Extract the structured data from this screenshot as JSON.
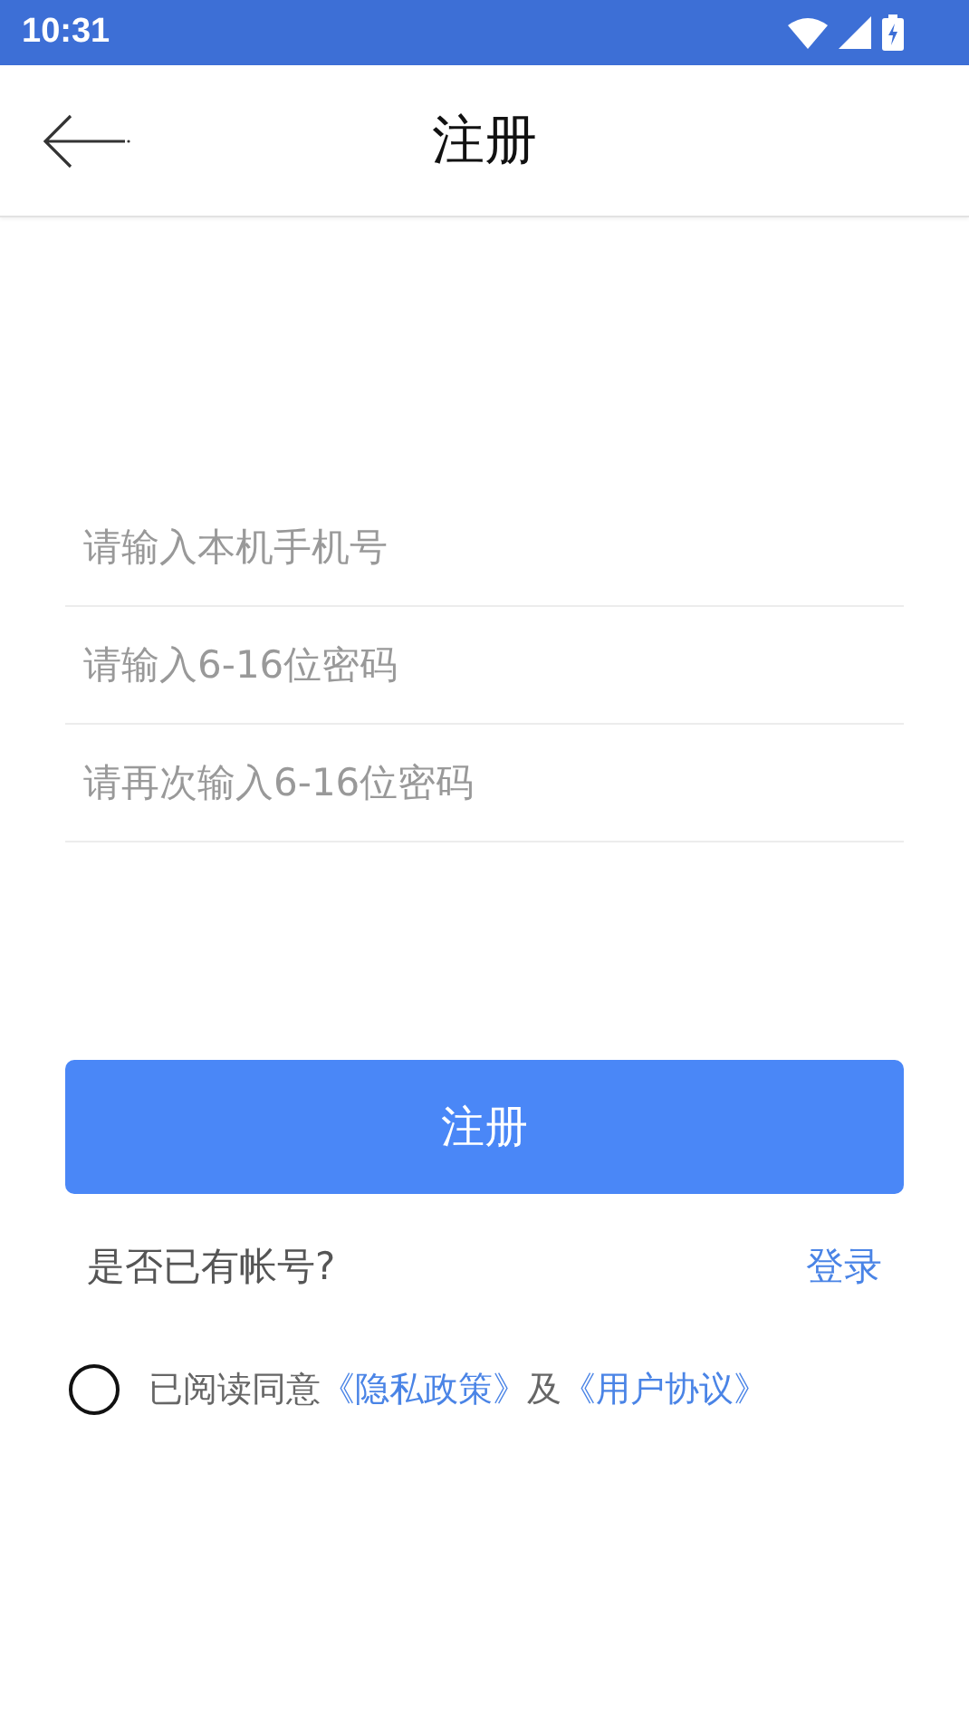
{
  "status_bar": {
    "time": "10:31"
  },
  "header": {
    "title": "注册"
  },
  "fields": [
    {
      "placeholder": "请输入本机手机号"
    },
    {
      "placeholder": "请输入6-16位密码"
    },
    {
      "placeholder": "请再次输入6-16位密码"
    }
  ],
  "submit_button": "注册",
  "login_prompt": {
    "text": "是否已有帐号?",
    "link": "登录"
  },
  "agreement": {
    "checked": false,
    "parts": [
      {
        "kind": "text",
        "text": "已阅读同意"
      },
      {
        "kind": "link",
        "text": "《隐私政策》"
      },
      {
        "kind": "text",
        "text": "及"
      },
      {
        "kind": "link",
        "text": "《用户协议》"
      }
    ]
  }
}
